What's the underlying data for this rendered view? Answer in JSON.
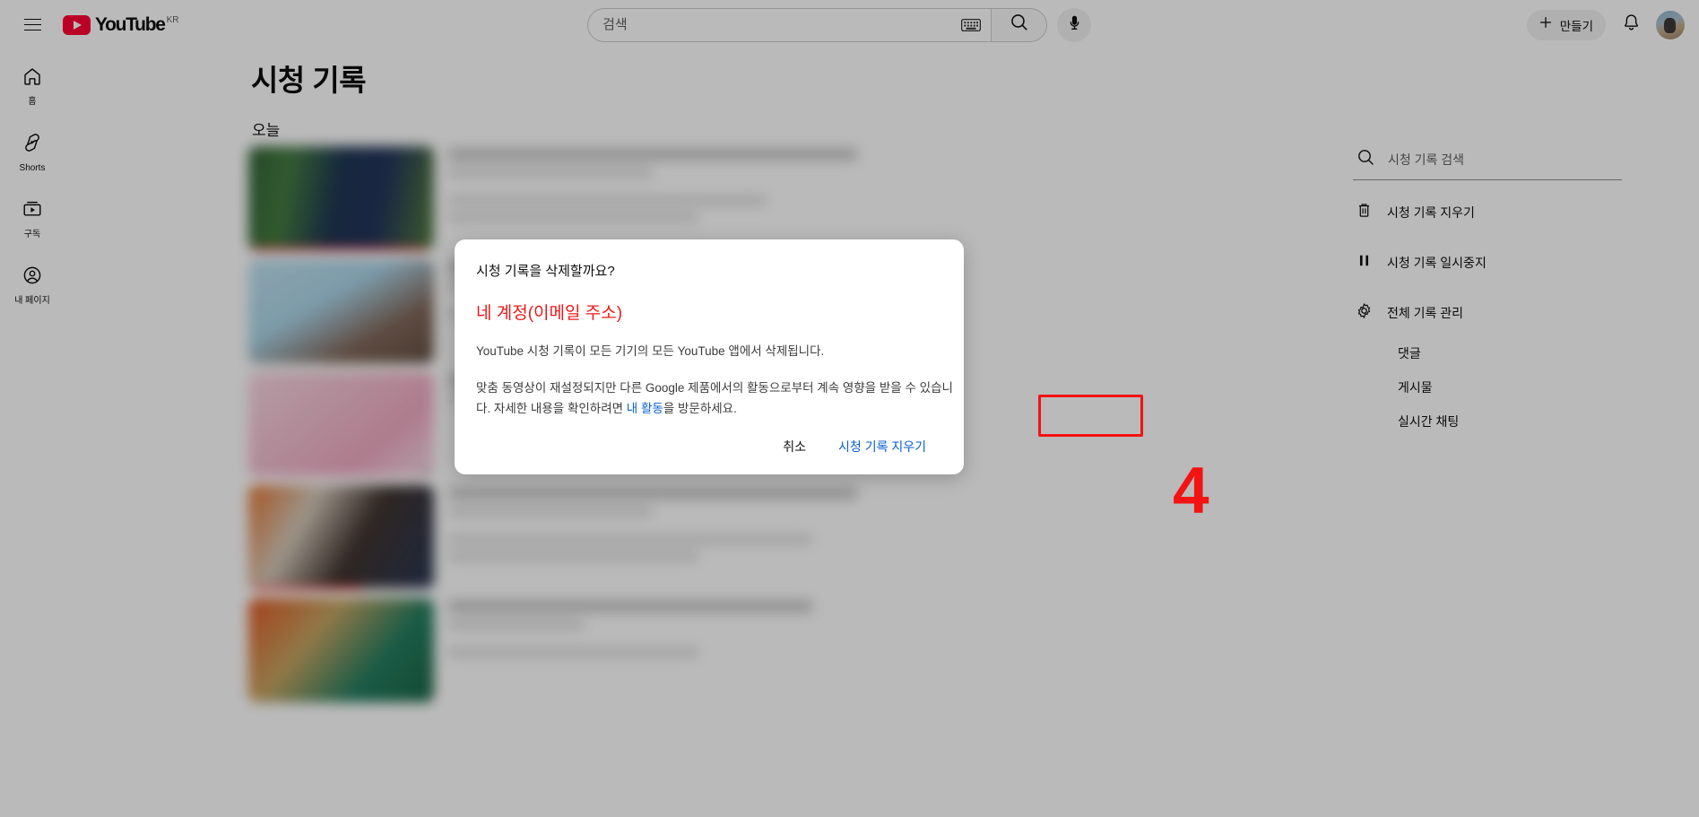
{
  "masthead": {
    "guide_icon": "hamburger-menu-icon",
    "logo_text": "YouTube",
    "logo_country": "KR",
    "search_placeholder": "검색",
    "search_value": "",
    "keyboard_icon": "keyboard-icon",
    "search_icon": "search-icon",
    "mic_icon": "microphone-icon",
    "create_label": "만들기",
    "create_icon": "plus-icon",
    "notifications_icon": "bell-icon",
    "avatar_icon": "user-avatar"
  },
  "mini_guide": {
    "items": [
      {
        "label": "홈",
        "icon": "home-icon"
      },
      {
        "label": "Shorts",
        "icon": "shorts-icon"
      },
      {
        "label": "구독",
        "icon": "subscriptions-icon"
      },
      {
        "label": "내 페이지",
        "icon": "you-account-icon"
      }
    ]
  },
  "main": {
    "page_title": "시청 기록",
    "section_heading": "오늘"
  },
  "history_panel": {
    "search_placeholder": "시청 기록 검색",
    "search_value": "",
    "search_icon": "search-icon",
    "items": [
      {
        "label": "시청 기록 지우기",
        "icon": "trash-icon"
      },
      {
        "label": "시청 기록 일시중지",
        "icon": "pause-icon"
      },
      {
        "label": "전체 기록 관리",
        "icon": "gear-icon"
      }
    ],
    "sub_items": [
      {
        "label": "댓글"
      },
      {
        "label": "게시물"
      },
      {
        "label": "실시간 채팅"
      }
    ]
  },
  "dialog": {
    "title": "시청 기록을 삭제할까요?",
    "account": "네 계정(이메일 주소)",
    "paragraph1": "YouTube 시청 기록이 모든 기기의 모든 YouTube 앱에서 삭제됩니다.",
    "paragraph2_before": " 맞춤 동영상이 재설정되지만 다른 Google 제품에서의 활동으로부터 계속 영향을 받을 수 있습니다. 자세한 내용을 확인하려면 ",
    "paragraph2_link": "내 활동",
    "paragraph2_after": "을 방문하세요.",
    "cancel_label": "취소",
    "confirm_label": "시청 기록 지우기"
  },
  "annotation": {
    "step_number": "4",
    "color": "#f41212"
  },
  "colors": {
    "brand_red": "#ff0033",
    "link_blue": "#065fd4",
    "account_red": "#f01818",
    "scrim": "rgba(0,0,0,0.27)"
  }
}
